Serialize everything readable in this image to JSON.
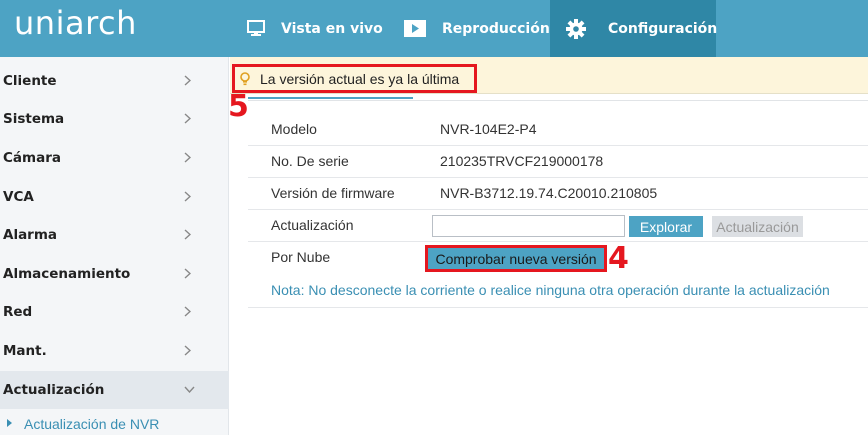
{
  "app": {
    "logo_text": "uniarch"
  },
  "nav": {
    "items": [
      {
        "label": "Vista en vivo",
        "icon": "monitor-icon"
      },
      {
        "label": "Reproducción",
        "icon": "play-icon"
      },
      {
        "label": "Configuración",
        "icon": "gear-icon",
        "active": true
      }
    ]
  },
  "sidebar": {
    "items": [
      {
        "label": "Cliente"
      },
      {
        "label": "Sistema"
      },
      {
        "label": "Cámara"
      },
      {
        "label": "VCA"
      },
      {
        "label": "Alarma"
      },
      {
        "label": "Almacenamiento"
      },
      {
        "label": "Red"
      },
      {
        "label": "Mant."
      },
      {
        "label": "Actualización",
        "expanded": true
      }
    ],
    "subitem": {
      "label": "Actualización de NVR"
    }
  },
  "notice": {
    "text": "La versión actual es ya la última",
    "icon": "lightbulb-icon"
  },
  "annotations": {
    "step5": "5",
    "step4": "4",
    "color": "#e5171f"
  },
  "info": {
    "model_label": "Modelo",
    "model_value": "NVR-104E2-P4",
    "serial_label": "No. De serie",
    "serial_value": "210235TRVCF219000178",
    "firmware_label": "Versión de firmware",
    "firmware_value": "NVR-B3712.19.74.C20010.210805",
    "update_label": "Actualización",
    "browse_button": "Explorar",
    "update_button": "Actualización",
    "cloud_label": "Por Nube",
    "check_button": "Comprobar nueva versión",
    "note": "Nota: No desconecte la corriente o realice ninguna otra operación durante la actualización"
  },
  "colors": {
    "header": "#4da3c4",
    "header_active": "#2f87a6",
    "link": "#3a8fb3",
    "notice_bg": "#fdf5db"
  }
}
